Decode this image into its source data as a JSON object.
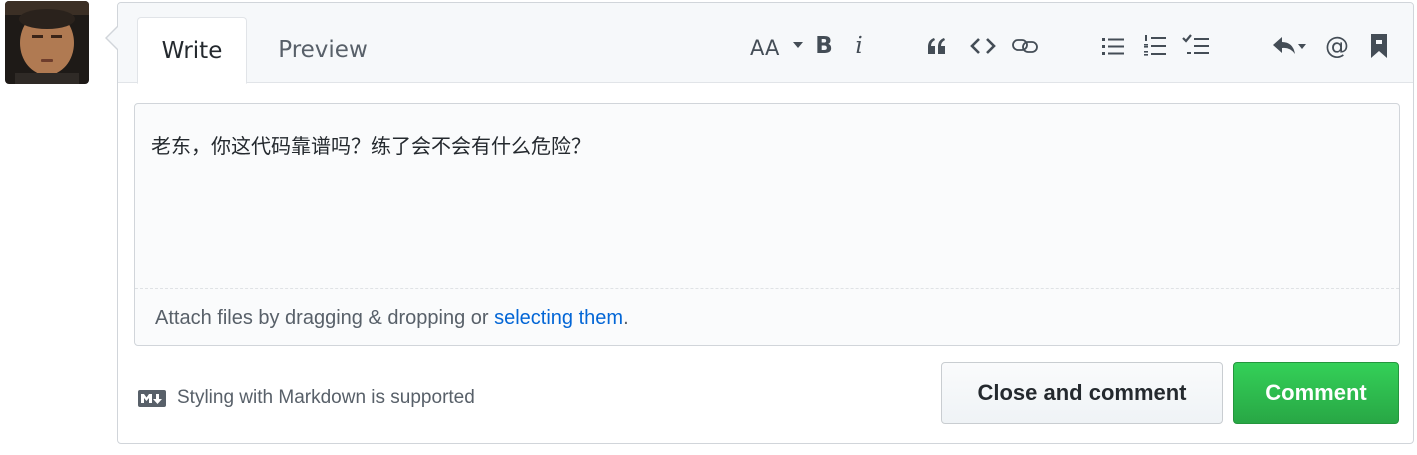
{
  "tabs": {
    "write": "Write",
    "preview": "Preview"
  },
  "toolbar": {
    "icons": [
      "text-size-icon",
      "bold-icon",
      "italic-icon",
      "quote-icon",
      "code-icon",
      "link-icon",
      "unordered-list-icon",
      "ordered-list-icon",
      "task-list-icon",
      "reply-icon",
      "mention-icon",
      "bookmark-icon"
    ],
    "bold_label": "B",
    "italic_label": "i",
    "mention_label": "@"
  },
  "editor": {
    "value": "老东，你这代码靠谱吗？练了会不会有什么危险？",
    "attach_prefix": "Attach files by dragging & dropping or ",
    "attach_link": "selecting them",
    "attach_suffix": "."
  },
  "footer": {
    "markdown_note": "Styling with Markdown is supported"
  },
  "buttons": {
    "close_and_comment": "Close and comment",
    "comment": "Comment"
  },
  "colors": {
    "link": "#0366d6",
    "primary_button": "#2cbe4e",
    "border": "#d1d5da"
  }
}
